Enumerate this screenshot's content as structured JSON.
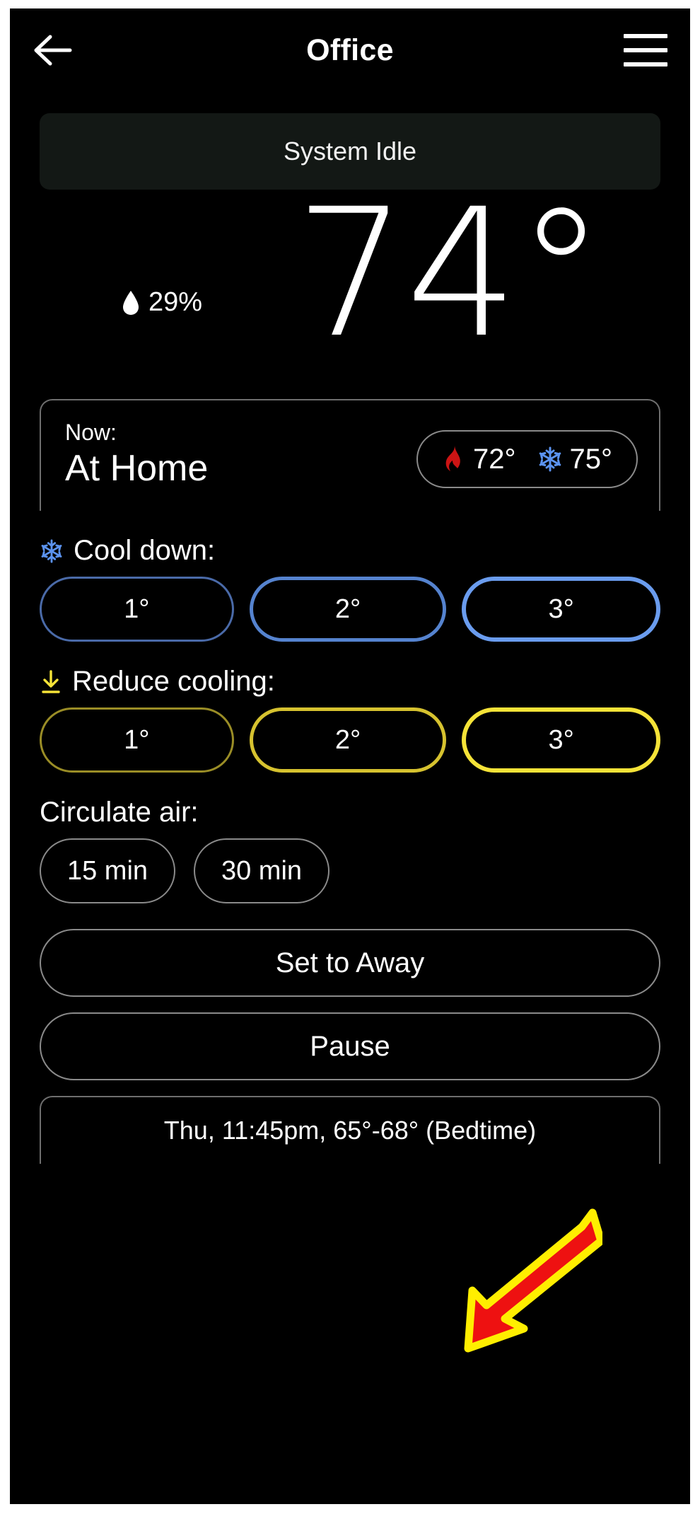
{
  "header": {
    "title": "Office",
    "back_icon": "arrow-left-icon",
    "menu_icon": "hamburger-menu-icon"
  },
  "status": {
    "text": "System Idle"
  },
  "current": {
    "temperature": "74°",
    "humidity_value": "29%",
    "humidity_icon": "water-drop-icon"
  },
  "now_card": {
    "label": "Now:",
    "mode": "At Home",
    "heat_icon": "flame-icon",
    "heat_setpoint": "72°",
    "cool_icon": "snowflake-icon",
    "cool_setpoint": "75°"
  },
  "cool_down": {
    "icon": "snowflake-icon",
    "title": "Cool down:",
    "options": [
      "1°",
      "2°",
      "3°"
    ]
  },
  "reduce_cooling": {
    "icon": "arrow-down-to-line-icon",
    "title": "Reduce cooling:",
    "options": [
      "1°",
      "2°",
      "3°"
    ]
  },
  "circulate_air": {
    "title": "Circulate air:",
    "options": [
      "15 min",
      "30 min"
    ]
  },
  "actions": [
    {
      "label": "Set to Away"
    },
    {
      "label": "Pause"
    }
  ],
  "schedule": {
    "text": "Thu, 11:45pm, 65°-68° (Bedtime)"
  },
  "annotation": {
    "type": "arrow",
    "points_to": "Pause",
    "fill_color": "#ee1111",
    "stroke_color": "#ffee00"
  },
  "colors": {
    "background": "#000000",
    "banner_background": "#131815",
    "cool_accent": "#6a9cee",
    "warm_accent": "#f5e338",
    "heat_accent": "#cc1414",
    "border": "#8a8a8a"
  }
}
